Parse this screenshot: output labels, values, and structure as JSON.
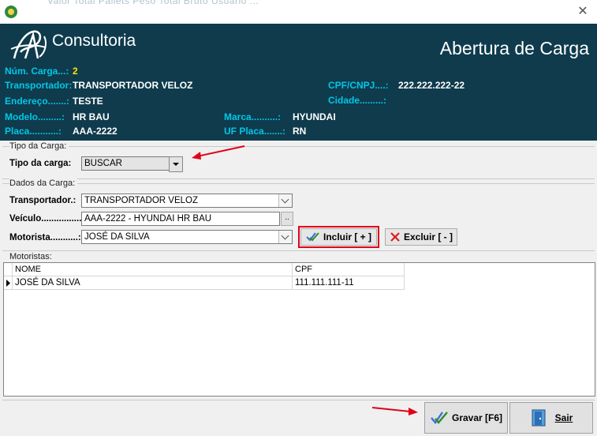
{
  "window": {
    "bleed_text": "Valor Total Pallets           Peso Total Bruto           Usuario  ...",
    "close_glyph": "✕"
  },
  "header": {
    "logo_text": "Consultoria",
    "title": "Abertura de Carga",
    "fields": {
      "num_carga_label": "Núm. Carga...:",
      "num_carga_value": "2",
      "transportador_label": "Transportador:",
      "transportador_value": "TRANSPORTADOR VELOZ",
      "endereco_label": "Endereço.......:",
      "endereco_value": "TESTE",
      "modelo_label": "Modelo.........:",
      "modelo_value": "HR BAU",
      "placa_label": "Placa...........:",
      "placa_value": "AAA-2222",
      "cpf_label": "CPF/CNPJ....:",
      "cpf_value": "222.222.222-22",
      "cidade_label": "Cidade.........:",
      "cidade_value": "",
      "marca_label": "Marca..........:",
      "marca_value": "HYUNDAI",
      "uf_label": "UF Placa.......:",
      "uf_value": "RN"
    }
  },
  "tipo_group": {
    "title": "Tipo da Carga:",
    "label": "Tipo da carga:",
    "value": "BUSCAR"
  },
  "dados_group": {
    "title": "Dados da Carga:",
    "transportador_label": "Transportador.:",
    "transportador_value": "TRANSPORTADOR VELOZ",
    "veiculo_label": "Veículo.................:",
    "veiculo_value": "AAA-2222 - HYUNDAI HR BAU",
    "veiculo_btn": "..",
    "motorista_label": "Motorista...........:",
    "motorista_value": "JOSÉ DA SILVA",
    "incluir_label": "Incluir [ + ]",
    "excluir_label": "Excluir [ - ]"
  },
  "motoristas": {
    "title": "Motoristas:",
    "columns": [
      "NOME",
      "CPF"
    ],
    "rows": [
      {
        "nome": "JOSÉ DA SILVA",
        "cpf": "111.111.111-11"
      }
    ]
  },
  "footer": {
    "gravar_label": "Gravar [F6]",
    "sair_label": "Sair"
  },
  "colors": {
    "header_bg": "#0f3b4d",
    "label_cyan": "#00c7e6",
    "accent_yellow": "#ffe400",
    "highlight_red": "#e0001a"
  }
}
